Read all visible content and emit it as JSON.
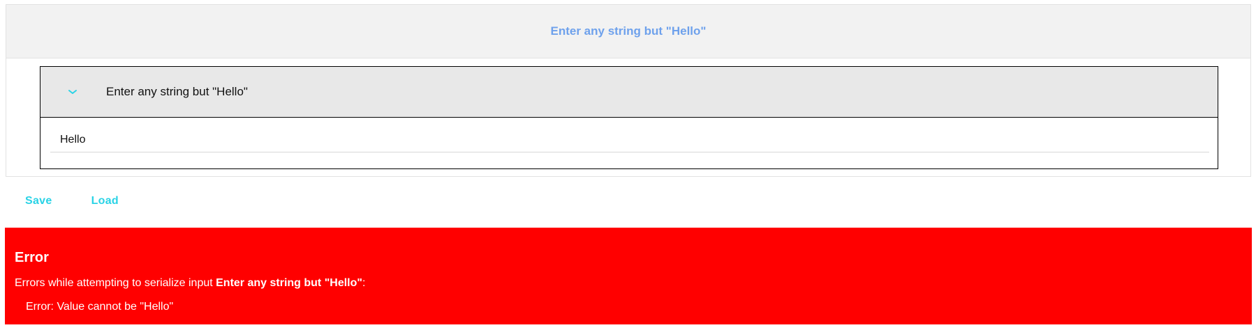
{
  "form": {
    "title": "Enter any string but \"Hello\"",
    "field": {
      "label": "Enter any string but \"Hello\"",
      "value": "Hello",
      "expand_icon": "chevron-down-icon"
    }
  },
  "actions": {
    "save_label": "Save",
    "load_label": "Load"
  },
  "error": {
    "title": "Error",
    "message_prefix": "Errors while attempting to serialize input ",
    "message_field": "Enter any string but \"Hello\"",
    "message_suffix": ":",
    "detail": "Error: Value cannot be \"Hello\""
  },
  "colors": {
    "accent": "#2ad3e6",
    "header_text": "#6ea1ec",
    "error_background": "#ff0000"
  }
}
